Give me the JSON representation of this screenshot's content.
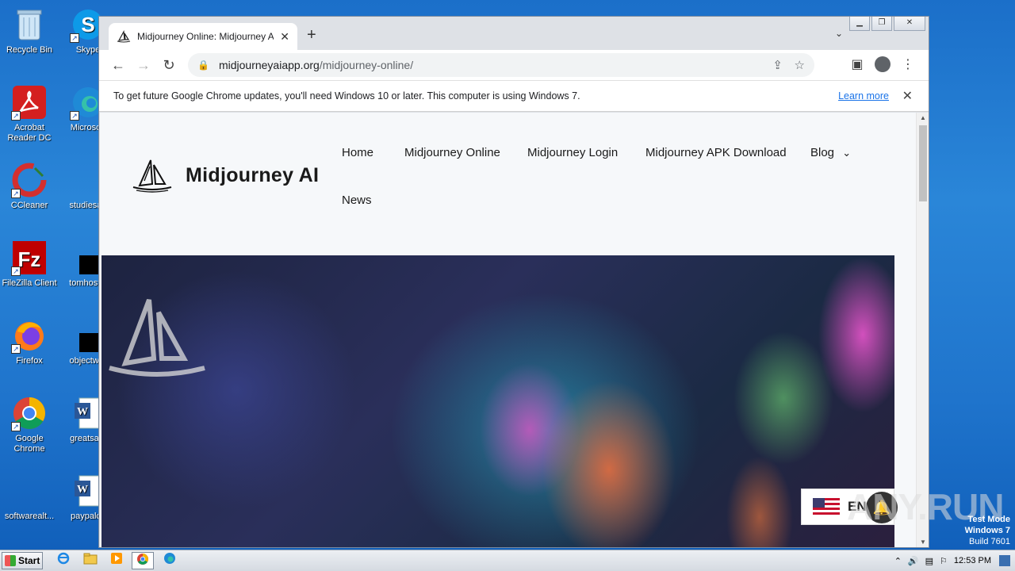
{
  "desktop": {
    "icons": [
      {
        "label": "Recycle Bin"
      },
      {
        "label": "Skype"
      },
      {
        "label": "Acrobat Reader DC"
      },
      {
        "label": "Microsoft"
      },
      {
        "label": "CCleaner"
      },
      {
        "label": "studiesag"
      },
      {
        "label": "FileZilla Client"
      },
      {
        "label": "tomhostin"
      },
      {
        "label": "Firefox"
      },
      {
        "label": "objectwor"
      },
      {
        "label": "Google Chrome"
      },
      {
        "label": "greatsafe"
      },
      {
        "label": "softwarealt..."
      },
      {
        "label": "paypalca"
      }
    ]
  },
  "browser": {
    "tab_title": "Midjourney Online: Midjourney Ai Online",
    "tab_close": "✕",
    "new_tab": "+",
    "url_domain": "midjourneyaiapp.org",
    "url_path": "/midjourney-online/",
    "infobar_message": "To get future Google Chrome updates, you'll need Windows 10 or later. This computer is using Windows 7.",
    "infobar_link": "Learn more",
    "infobar_close": "✕"
  },
  "site": {
    "brand": "Midjourney AI",
    "nav": [
      "Home",
      "Midjourney Online",
      "Midjourney Login",
      "Midjourney APK Download",
      "Blog",
      "News"
    ],
    "blog_caret": "⌄",
    "language": "EN"
  },
  "overlay": {
    "watermark": "ANY.RUN",
    "test_mode": "Test Mode",
    "os": "Windows 7",
    "build": "Build 7601"
  },
  "taskbar": {
    "start_label": "Start",
    "clock": "12:53 PM"
  }
}
